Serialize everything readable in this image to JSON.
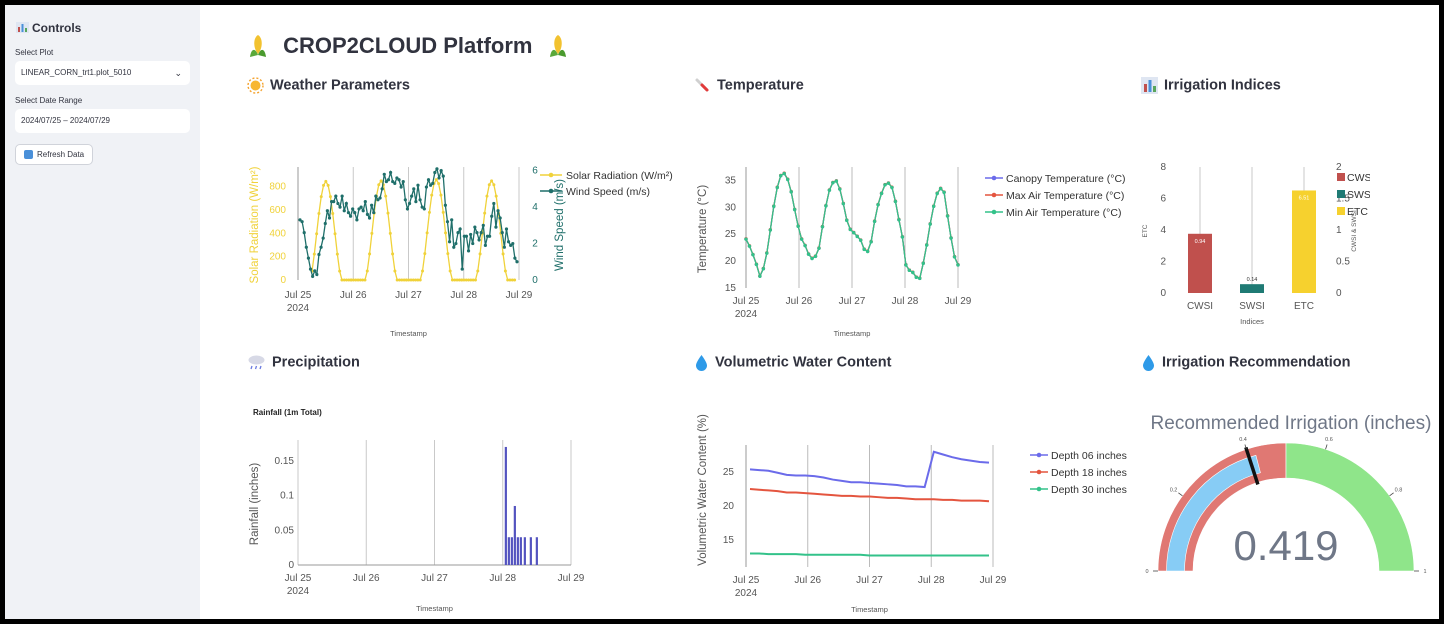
{
  "sidebar": {
    "title": "Controls",
    "plot_label": "Select Plot",
    "plot_value": "LINEAR_CORN_trt1.plot_5010",
    "date_label": "Select Date Range",
    "date_value": "2024/07/25 – 2024/07/29",
    "refresh_label": "Refresh Data"
  },
  "page": {
    "title": "CROP2CLOUD Platform"
  },
  "sections": {
    "weather": "Weather Parameters",
    "temperature": "Temperature",
    "indices": "Irrigation Indices",
    "precip": "Precipitation",
    "vwc": "Volumetric Water Content",
    "recommend": "Irrigation Recommendation"
  },
  "colors": {
    "solar": "#f0d23a",
    "wind": "#1f6f6a",
    "canopy": "#6b6bea",
    "maxair": "#e4553f",
    "minair": "#33c28a",
    "cwsi": "#c0504d",
    "swsi": "#1f7a74",
    "etc": "#f6d12e",
    "rain": "#5353bf",
    "gauge_red": "#e07873",
    "gauge_green": "#8fe58a",
    "gauge_bar": "#87ccf5"
  },
  "chart_data": [
    {
      "id": "weather",
      "type": "line",
      "xlabel": "Timestamp",
      "x_ticks": [
        "Jul 25",
        "Jul 26",
        "Jul 27",
        "Jul 28",
        "Jul 29"
      ],
      "x_year": "2024",
      "y_left_label": "Solar Radiation (W/m²)",
      "y_left_ticks": [
        "0",
        "200",
        "400",
        "600",
        "800"
      ],
      "y_left_range": [
        0,
        900
      ],
      "y_right_label": "Wind Speed (m/s)",
      "y_right_ticks": [
        "0",
        "2",
        "4",
        "6"
      ],
      "y_right_range": [
        0,
        6.2
      ],
      "series": [
        {
          "name": "Solar Radiation (W/m²)",
          "axis": "left",
          "peaks": [
            845,
            850,
            860,
            850
          ]
        },
        {
          "name": "Wind Speed (m/s)",
          "axis": "right",
          "values": [
            3.3,
            3.2,
            2.6,
            1.8,
            1.2,
            0.6,
            0.2,
            0.5,
            0.3,
            1.4,
            1.8,
            2.3,
            3.1,
            3.8,
            3.4,
            4.3,
            4.3,
            4.6,
            4.2,
            4.0,
            4.6,
            3.8,
            4.2,
            3.7,
            3.5,
            3.9,
            3.7,
            3.3,
            3.9,
            4.0,
            3.8,
            4.3,
            3.6,
            3.4,
            4.1,
            3.7,
            4.6,
            4.4,
            4.5,
            5.0,
            5.8,
            5.4,
            5.5,
            5.9,
            5.4,
            5.3,
            5.6,
            5.5,
            5.1,
            5.4,
            4.4,
            3.9,
            4.2,
            4.6,
            5.0,
            4.3,
            5.2,
            4.4,
            4.0,
            3.9,
            5.1,
            5.5,
            5.2,
            5.3,
            5.9,
            6.1,
            5.6,
            6.0,
            5.7,
            4.1,
            3.2,
            2.1,
            3.3,
            1.8,
            2.0,
            2.6,
            2.8,
            0.6,
            2.4,
            2.4,
            1.6,
            2.5,
            2.0,
            2.9,
            2.6,
            2.2,
            2.6,
            3.0,
            1.9,
            2.4,
            2.4,
            3.5,
            4.2,
            2.9,
            3.8,
            3.4,
            2.6,
            1.8,
            2.8,
            2.1,
            1.9,
            2.0,
            1.2,
            1.0
          ]
        }
      ]
    },
    {
      "id": "temperature",
      "type": "line",
      "xlabel": "Timestamp",
      "x_ticks": [
        "Jul 25",
        "Jul 26",
        "Jul 27",
        "Jul 28",
        "Jul 29"
      ],
      "x_year": "2024",
      "ylabel": "Temperature (°C)",
      "y_ticks": [
        "15",
        "20",
        "25",
        "30",
        "35"
      ],
      "ylim": [
        15,
        37.5
      ],
      "series": [
        {
          "name": "Canopy Temperature (°C)",
          "values": [
            24.1,
            22.8,
            21.2,
            19.4,
            17.2,
            18.6,
            21.5,
            25.8,
            30.2,
            33.7,
            35.9,
            36.3,
            35.2,
            32.9,
            29.6,
            26.5,
            24.1,
            22.9,
            21.3,
            20.5,
            20.9,
            22.4,
            26.4,
            30.3,
            33.2,
            34.6,
            34.9,
            33.4,
            30.7,
            27.6,
            25.9,
            25.3,
            24.6,
            23.9,
            22.2,
            21.8,
            23.6,
            27.4,
            30.5,
            32.6,
            34.2,
            34.5,
            33.7,
            31.1,
            27.7,
            24.5,
            19.3,
            18.3,
            17.9,
            17.0,
            16.8,
            19.6,
            23.0,
            26.9,
            30.2,
            32.6,
            33.5,
            32.8,
            28.4,
            24.3,
            20.8,
            19.3
          ]
        },
        {
          "name": "Max Air Temperature (°C)"
        },
        {
          "name": "Min Air Temperature (°C)"
        }
      ]
    },
    {
      "id": "indices",
      "type": "bar",
      "categories": [
        "CWSI",
        "SWSI",
        "ETC"
      ],
      "xlabel": "Indices",
      "ylabel_left": "ETC",
      "ylabel_right": "CWSI & SWSI",
      "y_left_ticks": [
        "0",
        "2",
        "4",
        "6",
        "8"
      ],
      "y_right_ticks": [
        "0",
        "0.5",
        "1",
        "1.5",
        "2"
      ],
      "series": [
        {
          "name": "CWSI",
          "axis": "right",
          "value": 0.94,
          "label": "0.94"
        },
        {
          "name": "SWSI",
          "axis": "right",
          "value": 0.14,
          "label": "0.14"
        },
        {
          "name": "ETC",
          "axis": "left",
          "value": 6.51,
          "label": "6.51"
        }
      ]
    },
    {
      "id": "precip",
      "type": "bar",
      "title": "Rainfall (1m Total)",
      "xlabel": "Timestamp",
      "ylabel": "Rainfall (inches)",
      "x_ticks": [
        "Jul 25",
        "Jul 26",
        "Jul 27",
        "Jul 28",
        "Jul 29"
      ],
      "x_year": "2024",
      "y_ticks": [
        "0",
        "0.05",
        "0.1",
        "0.15"
      ],
      "ylim": [
        0,
        0.18
      ],
      "bars": [
        0.17,
        0.04,
        0.04,
        0.085,
        0.04,
        0.04,
        0.04,
        0.04,
        0.04
      ]
    },
    {
      "id": "vwc",
      "type": "line",
      "xlabel": "Timestamp",
      "ylabel": "Volumetric Water Content (%)",
      "x_ticks": [
        "Jul 25",
        "Jul 26",
        "Jul 27",
        "Jul 28",
        "Jul 29"
      ],
      "x_year": "2024",
      "y_ticks": [
        "15",
        "20",
        "25"
      ],
      "ylim": [
        11,
        29
      ],
      "series": [
        {
          "name": "Depth 06 inches",
          "values": [
            25.4,
            25.3,
            25.2,
            24.9,
            24.6,
            24.5,
            24.5,
            24.4,
            24.2,
            23.9,
            23.7,
            23.5,
            23.5,
            23.4,
            23.3,
            23.2,
            23.1,
            22.9,
            22.9,
            22.8,
            28.0,
            27.6,
            27.2,
            26.9,
            26.7,
            26.5,
            26.4
          ]
        },
        {
          "name": "Depth 18 inches",
          "values": [
            22.5,
            22.4,
            22.3,
            22.2,
            22.0,
            22.0,
            21.9,
            21.8,
            21.7,
            21.6,
            21.5,
            21.5,
            21.4,
            21.4,
            21.3,
            21.2,
            21.2,
            21.1,
            21.0,
            21.0,
            21.0,
            20.9,
            20.9,
            20.8,
            20.8,
            20.8,
            20.7
          ]
        },
        {
          "name": "Depth 30 inches",
          "values": [
            13.0,
            13.0,
            12.9,
            12.9,
            12.9,
            12.9,
            12.8,
            12.8,
            12.8,
            12.8,
            12.8,
            12.8,
            12.8,
            12.7,
            12.7,
            12.7,
            12.7,
            12.7,
            12.7,
            12.7,
            12.7,
            12.7,
            12.7,
            12.7,
            12.7,
            12.7,
            12.7
          ]
        }
      ]
    },
    {
      "id": "gauge",
      "type": "gauge",
      "title": "Recommended Irrigation (inches)",
      "value": 0.419,
      "value_label": "0.419",
      "range": [
        0,
        1
      ],
      "ticks": [
        "0",
        "0.2",
        "0.4",
        "0.6",
        "0.8",
        "1"
      ],
      "threshold": 0.4,
      "steps": [
        {
          "range": [
            0,
            0.5
          ],
          "color": "#e07873"
        },
        {
          "range": [
            0.5,
            1
          ],
          "color": "#8fe58a"
        }
      ]
    }
  ]
}
